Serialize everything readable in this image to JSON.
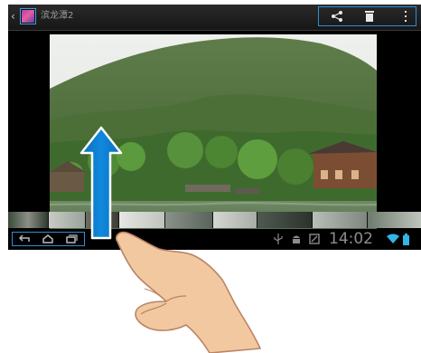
{
  "actionbar": {
    "back_glyph": "‹",
    "title": "滨龙潭2",
    "icons": [
      "share-icon",
      "delete-icon",
      "overflow-menu-icon"
    ]
  },
  "statusbar": {
    "time": "14:02",
    "icons": [
      "usb-icon",
      "android-debug-icon",
      "screenshot-icon",
      "wifi-icon",
      "battery-icon"
    ]
  },
  "navbar": {
    "buttons": [
      "back-button",
      "home-button",
      "recent-apps-button"
    ]
  },
  "gesture": {
    "direction": "swipe-up",
    "arrow_color": "#0a7ccd"
  },
  "colors": {
    "highlight": "#2e8fd3",
    "skin": "#f2c8a0"
  }
}
